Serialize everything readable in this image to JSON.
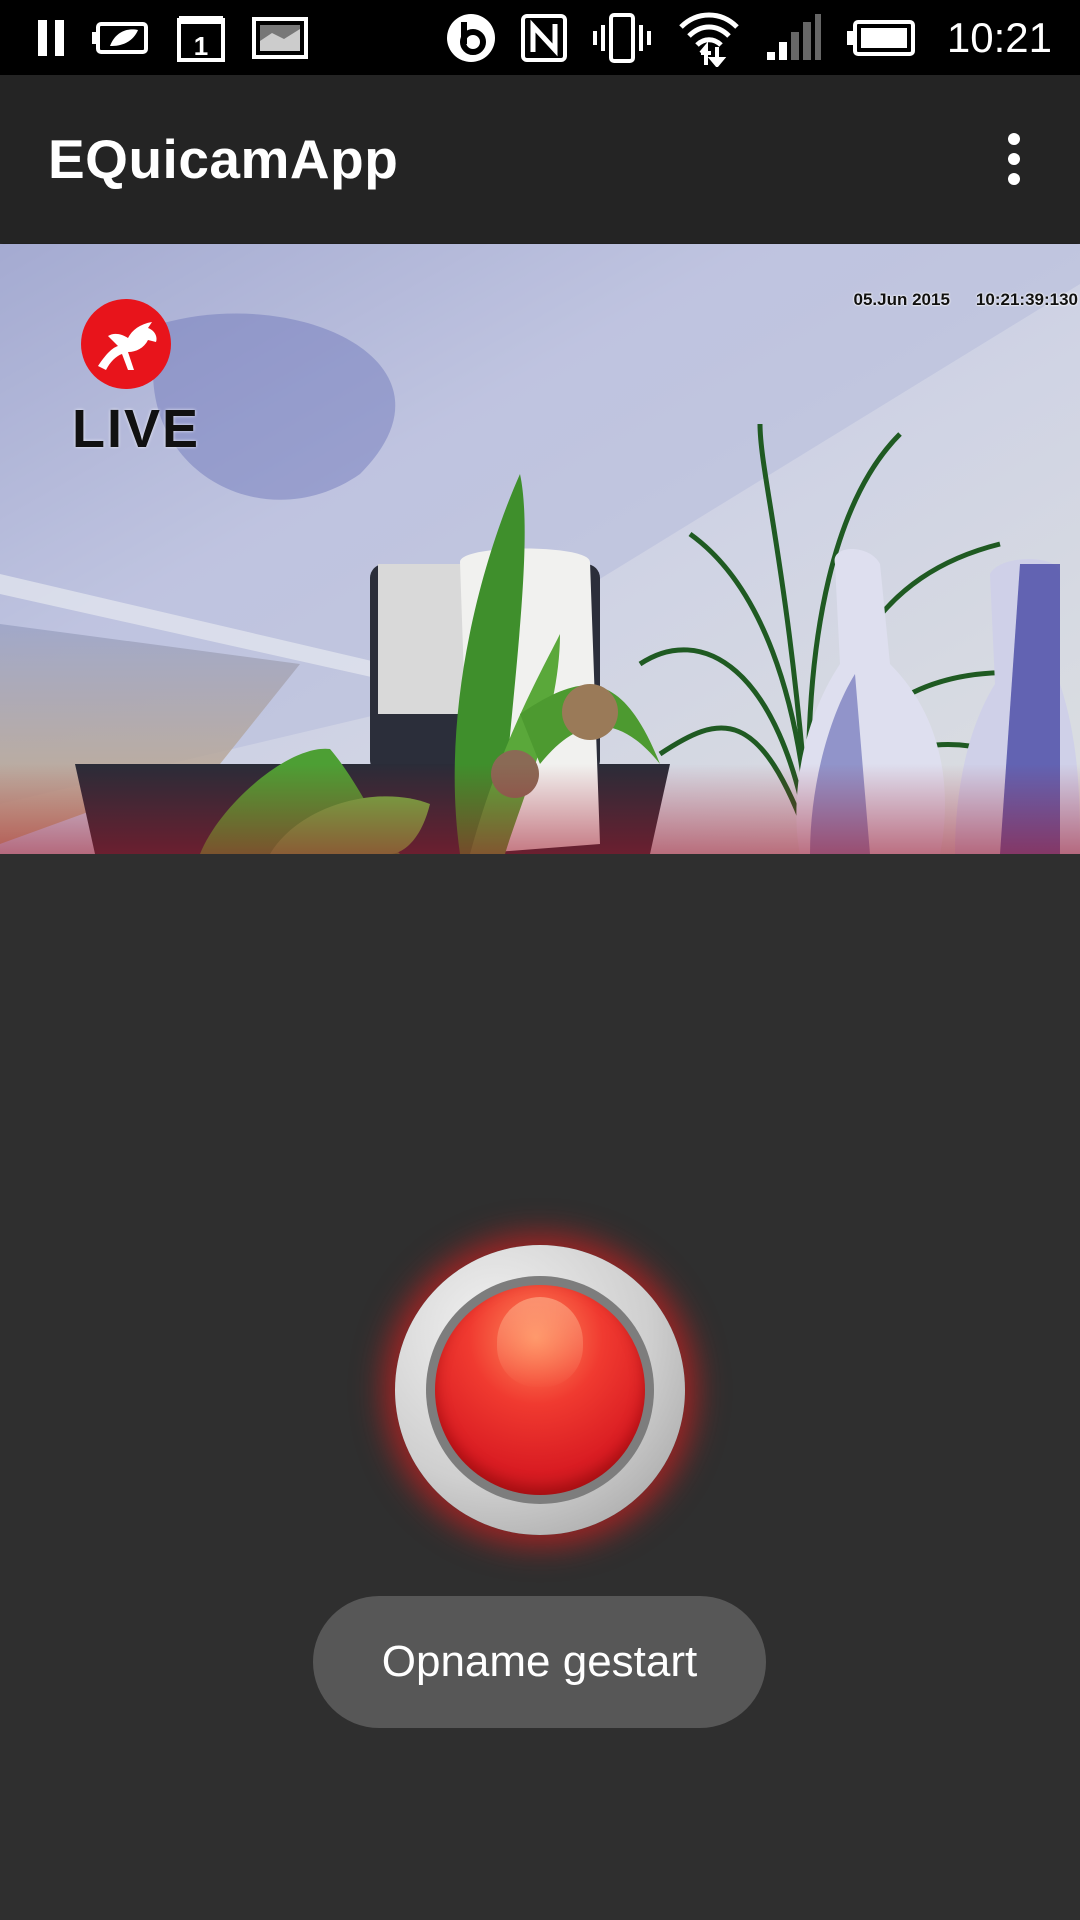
{
  "status_bar": {
    "time": "10:21",
    "left_icons": [
      "pause-icon",
      "battery-saver-icon",
      "calendar-icon",
      "gallery-icon"
    ],
    "right_icons": [
      "beats-icon",
      "nfc-icon",
      "vibrate-icon",
      "wifi-icon",
      "signal-icon",
      "battery-icon"
    ],
    "calendar_day": "1"
  },
  "app_bar": {
    "title": "EQuicamApp",
    "menu_icon": "overflow-menu-icon"
  },
  "camera_view": {
    "timestamp_date": "05.Jun 2015",
    "timestamp_time": "10:21:39:130",
    "live_label": "LIVE",
    "logo_icon": "horse-logo-icon",
    "logo_color": "#e8141b"
  },
  "record_button": {
    "icon": "record-button-icon",
    "color": "#e52a2a"
  },
  "toast": {
    "message": "Opname gestart"
  },
  "colors": {
    "background": "#2f2f2f",
    "app_bar": "#242424",
    "status_bar": "#000000",
    "toast": "#575757"
  }
}
